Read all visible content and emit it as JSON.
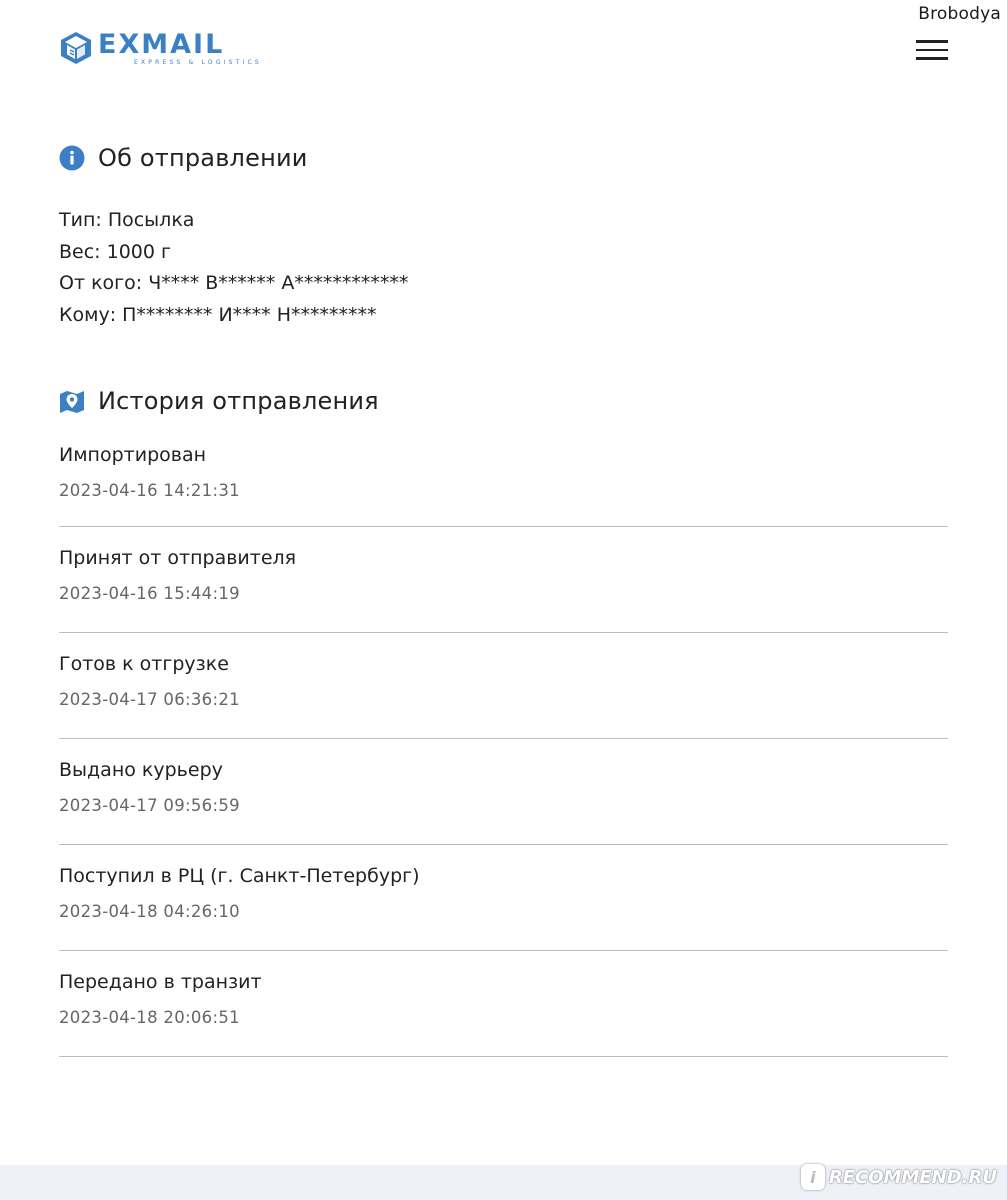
{
  "watermark_user": "Brobodya",
  "header": {
    "logo_name": "EXMAIL",
    "logo_tagline": "EXPRESS & LOGISTICS",
    "menu_icon": "hamburger-menu-icon"
  },
  "about": {
    "title": "Об отправлении",
    "icon": "info-icon",
    "lines": [
      "Тип: Посылка",
      "Вес: 1000 г",
      "От кого: Ч**** В****** А************",
      "Кому: П******** И**** Н*********"
    ]
  },
  "history": {
    "title": "История отправления",
    "icon": "map-pin-icon",
    "events": [
      {
        "status": "Импортирован",
        "date": "2023-04-16 14:21:31"
      },
      {
        "status": "Принят от отправителя",
        "date": "2023-04-16 15:44:19"
      },
      {
        "status": "Готов к отгрузке",
        "date": "2023-04-17 06:36:21"
      },
      {
        "status": "Выдано курьеру",
        "date": "2023-04-17 09:56:59"
      },
      {
        "status": "Поступил в РЦ (г. Санкт-Петербург)",
        "date": "2023-04-18 04:26:10"
      },
      {
        "status": "Передано в транзит",
        "date": "2023-04-18 20:06:51"
      }
    ]
  },
  "colors": {
    "brand": "#3b7fc4",
    "text": "#222222",
    "muted": "#666666",
    "divider": "#bdbdbd"
  },
  "watermark_site": "RECOMMEND.RU"
}
